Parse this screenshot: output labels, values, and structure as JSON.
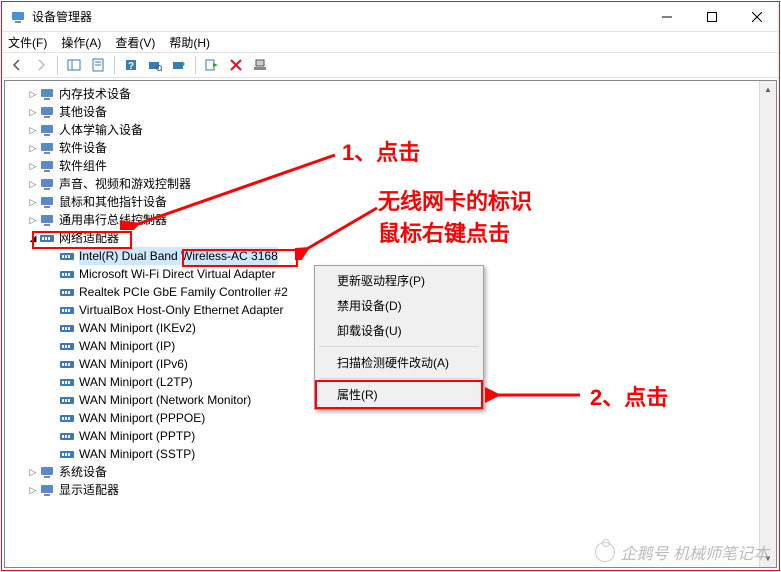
{
  "window": {
    "title": "设备管理器"
  },
  "menubar": [
    {
      "label": "文件(F)"
    },
    {
      "label": "操作(A)"
    },
    {
      "label": "查看(V)"
    },
    {
      "label": "帮助(H)"
    }
  ],
  "tree": {
    "collapsed": [
      {
        "label": "内存技术设备",
        "icon": "chip"
      },
      {
        "label": "其他设备",
        "icon": "other"
      },
      {
        "label": "人体学输入设备",
        "icon": "hid"
      },
      {
        "label": "软件设备",
        "icon": "software"
      },
      {
        "label": "软件组件",
        "icon": "component"
      },
      {
        "label": "声音、视频和游戏控制器",
        "icon": "audio"
      },
      {
        "label": "鼠标和其他指针设备",
        "icon": "mouse"
      },
      {
        "label": "通用串行总线控制器",
        "icon": "usb"
      }
    ],
    "network": {
      "label": "网络适配器",
      "children": [
        {
          "label": "Intel(R) Dual Band Wireless-AC 3168",
          "selected": true
        },
        {
          "label": "Microsoft Wi-Fi Direct Virtual Adapter"
        },
        {
          "label": "Realtek PCIe GbE Family Controller #2"
        },
        {
          "label": "VirtualBox Host-Only Ethernet Adapter"
        },
        {
          "label": "WAN Miniport (IKEv2)"
        },
        {
          "label": "WAN Miniport (IP)"
        },
        {
          "label": "WAN Miniport (IPv6)"
        },
        {
          "label": "WAN Miniport (L2TP)"
        },
        {
          "label": "WAN Miniport (Network Monitor)"
        },
        {
          "label": "WAN Miniport (PPPOE)"
        },
        {
          "label": "WAN Miniport (PPTP)"
        },
        {
          "label": "WAN Miniport (SSTP)"
        }
      ]
    },
    "after": [
      {
        "label": "系统设备",
        "icon": "system"
      },
      {
        "label": "显示适配器",
        "icon": "display"
      }
    ]
  },
  "context_menu": {
    "items": [
      {
        "label": "更新驱动程序(P)"
      },
      {
        "label": "禁用设备(D)"
      },
      {
        "label": "卸载设备(U)"
      },
      {
        "sep": true
      },
      {
        "label": "扫描检测硬件改动(A)"
      },
      {
        "sep": true
      },
      {
        "label": "属性(R)",
        "highlight": true
      }
    ]
  },
  "annotations": {
    "a1": "1、点击",
    "a2_line1": "无线网卡的标识",
    "a2_line2": "鼠标右键点击",
    "a3": "2、点击"
  },
  "watermark": "企鹅号 机械师笔记本"
}
